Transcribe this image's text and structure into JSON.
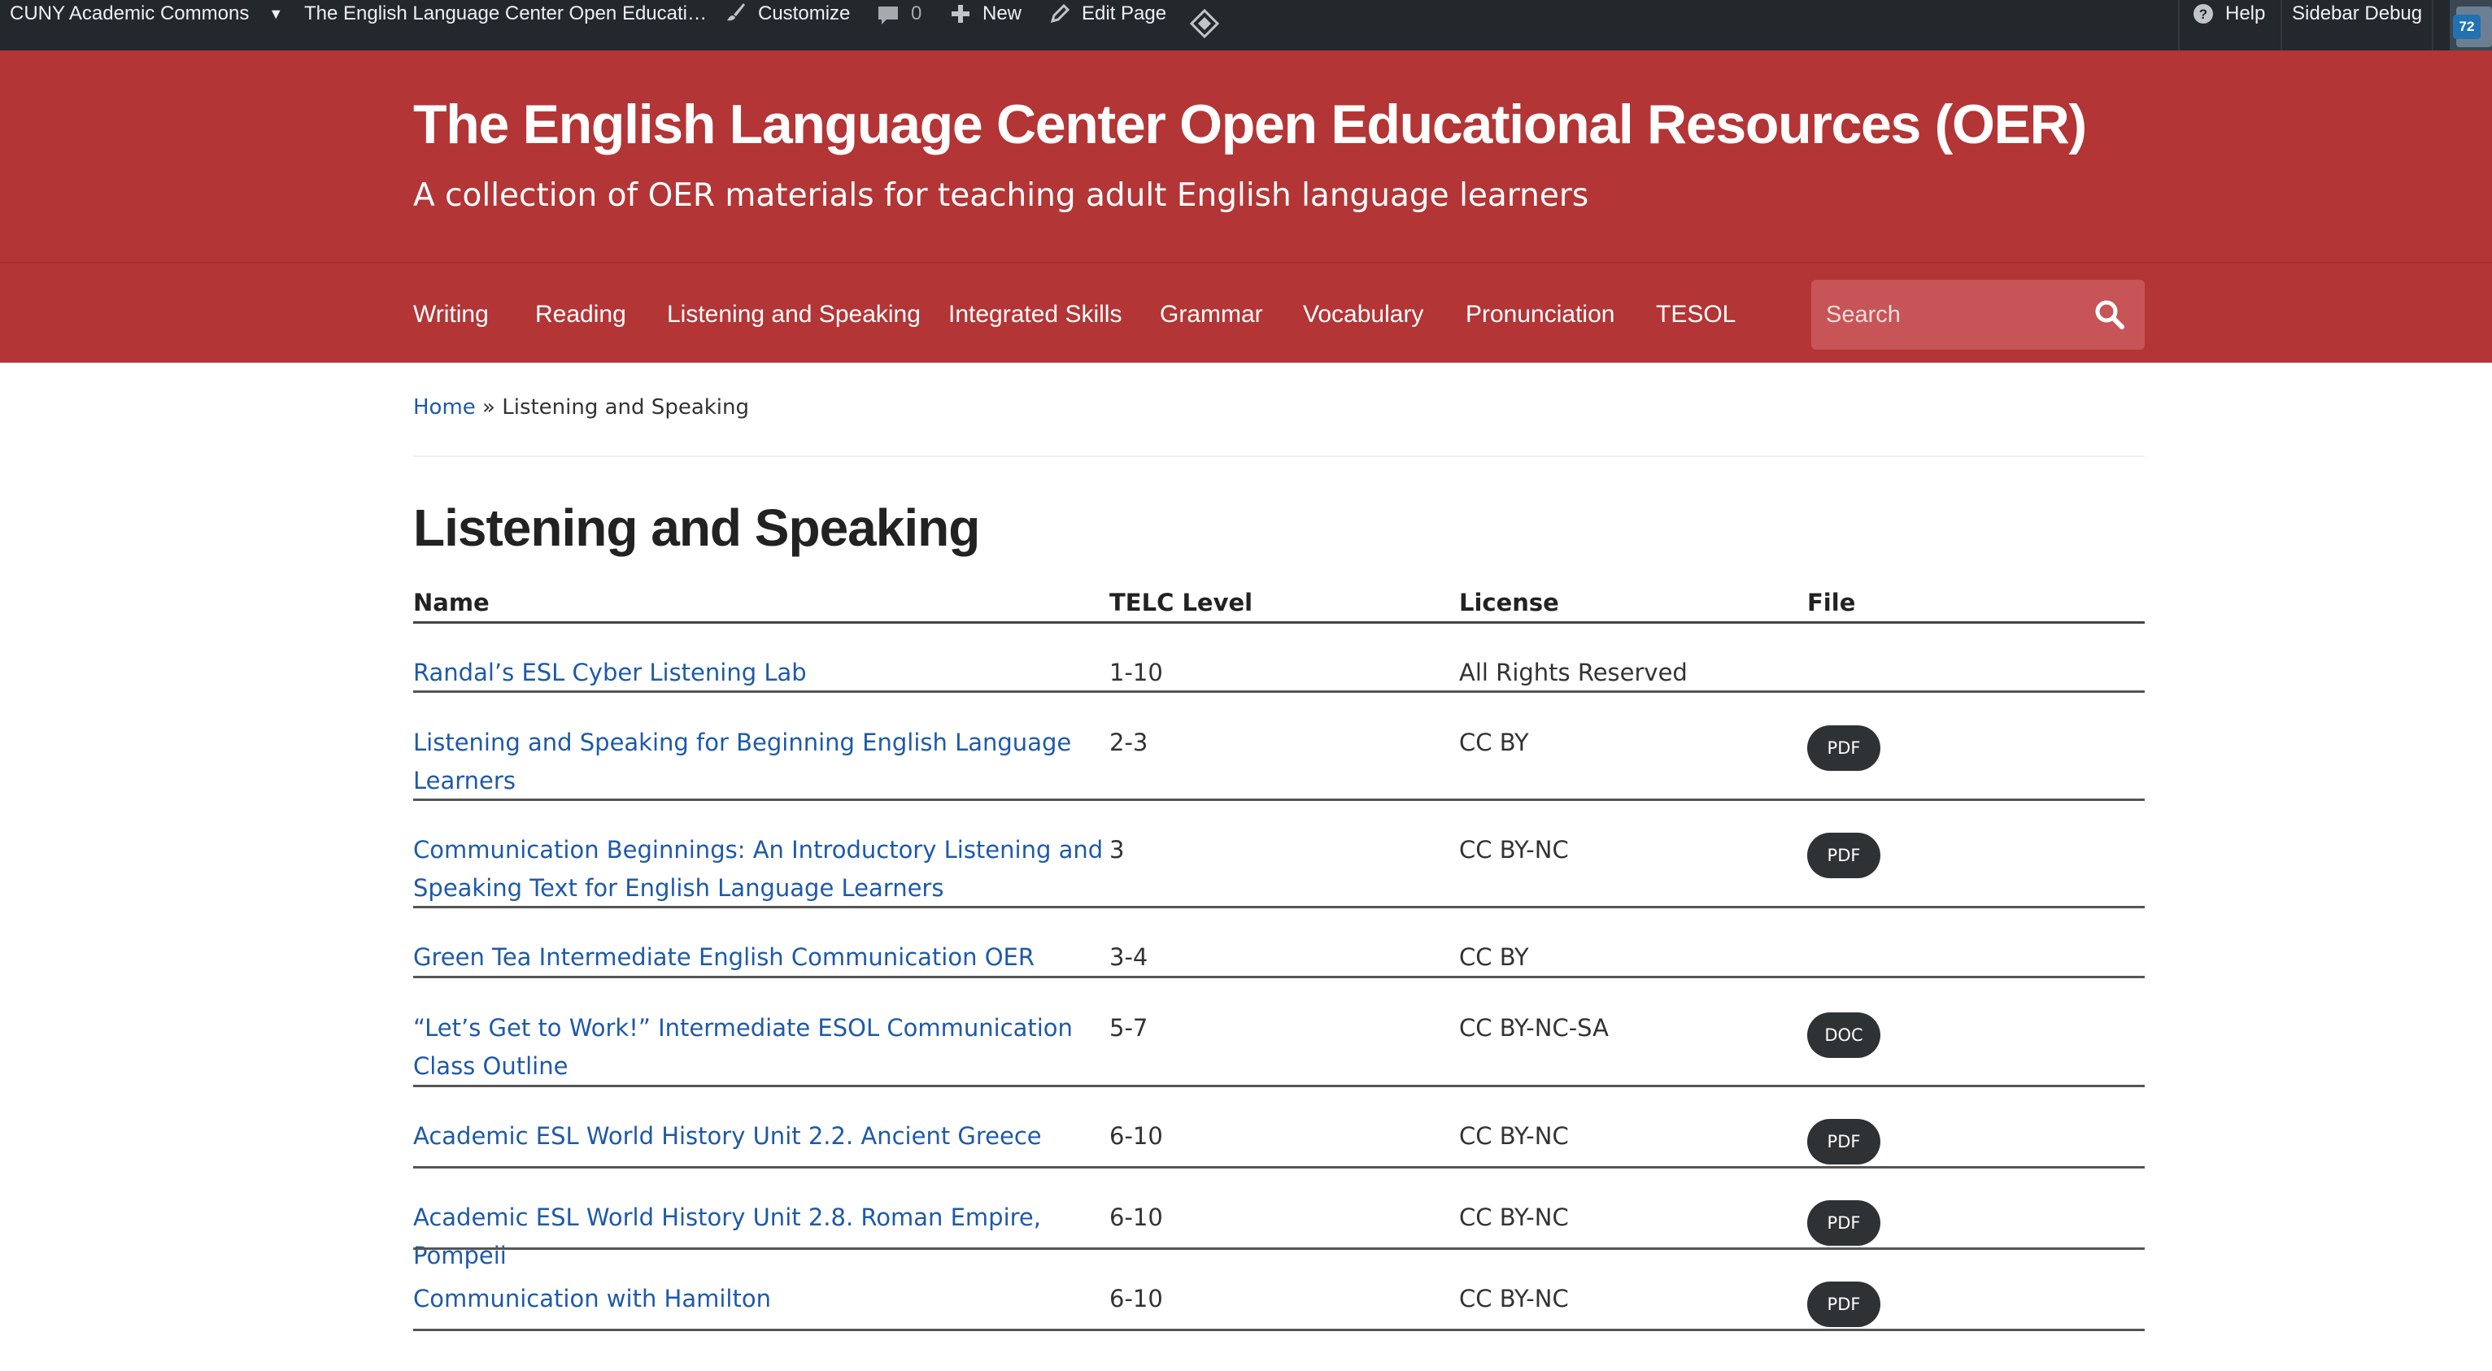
{
  "adminbar": {
    "site_network": "CUNY Academic Commons",
    "site_name": "The English Language Center Open Educati…",
    "customize": "Customize",
    "comments_count": "0",
    "new": "New",
    "edit_page": "Edit Page",
    "help": "Help",
    "sidebar_debug": "Sidebar Debug",
    "notif_count": "72"
  },
  "header": {
    "title": "The English Language Center Open Educational Resources (OER)",
    "description": "A collection of OER materials for teaching adult English language learners"
  },
  "nav": {
    "items": [
      "Writing",
      "Reading",
      "Listening and Speaking",
      "Integrated Skills",
      "Grammar",
      "Vocabulary",
      "Pronunciation",
      "TESOL"
    ],
    "search_placeholder": "Search"
  },
  "breadcrumb": {
    "home": "Home",
    "separator": "»",
    "current": "Listening and Speaking"
  },
  "page": {
    "title": "Listening and Speaking"
  },
  "table": {
    "headers": [
      "Name",
      "TELC Level",
      "License",
      "File"
    ],
    "rows": [
      {
        "name": "Randal’s ESL Cyber Listening Lab",
        "level": "1-10",
        "license": "All Rights Reserved",
        "file": ""
      },
      {
        "name": "Listening and Speaking for Beginning English Language Learners",
        "level": "2-3",
        "license": "CC BY",
        "file": "PDF"
      },
      {
        "name": "Communication Beginnings: An Introductory Listening and Speaking Text for English Language Learners",
        "level": "3",
        "license": "CC BY-NC",
        "file": "PDF"
      },
      {
        "name": "Green Tea Intermediate English Communication OER",
        "level": "3-4",
        "license": "CC BY",
        "file": ""
      },
      {
        "name": "“Let’s Get to Work!” Intermediate ESOL Communication Class Outline",
        "level": "5-7",
        "license": "CC BY-NC-SA",
        "file": "DOC"
      },
      {
        "name": "Academic ESL World History Unit 2.2. Ancient Greece",
        "level": "6-10",
        "license": "CC BY-NC",
        "file": "PDF"
      },
      {
        "name": "Academic ESL World History Unit 2.8. Roman Empire, Pompeii",
        "level": "6-10",
        "license": "CC BY-NC",
        "file": "PDF"
      },
      {
        "name": "Communication with Hamilton",
        "level": "6-10",
        "license": "CC BY-NC",
        "file": "PDF"
      }
    ]
  },
  "colors": {
    "brand": "#b33536",
    "link": "#1e5aa8",
    "adminbar": "#23282d"
  }
}
